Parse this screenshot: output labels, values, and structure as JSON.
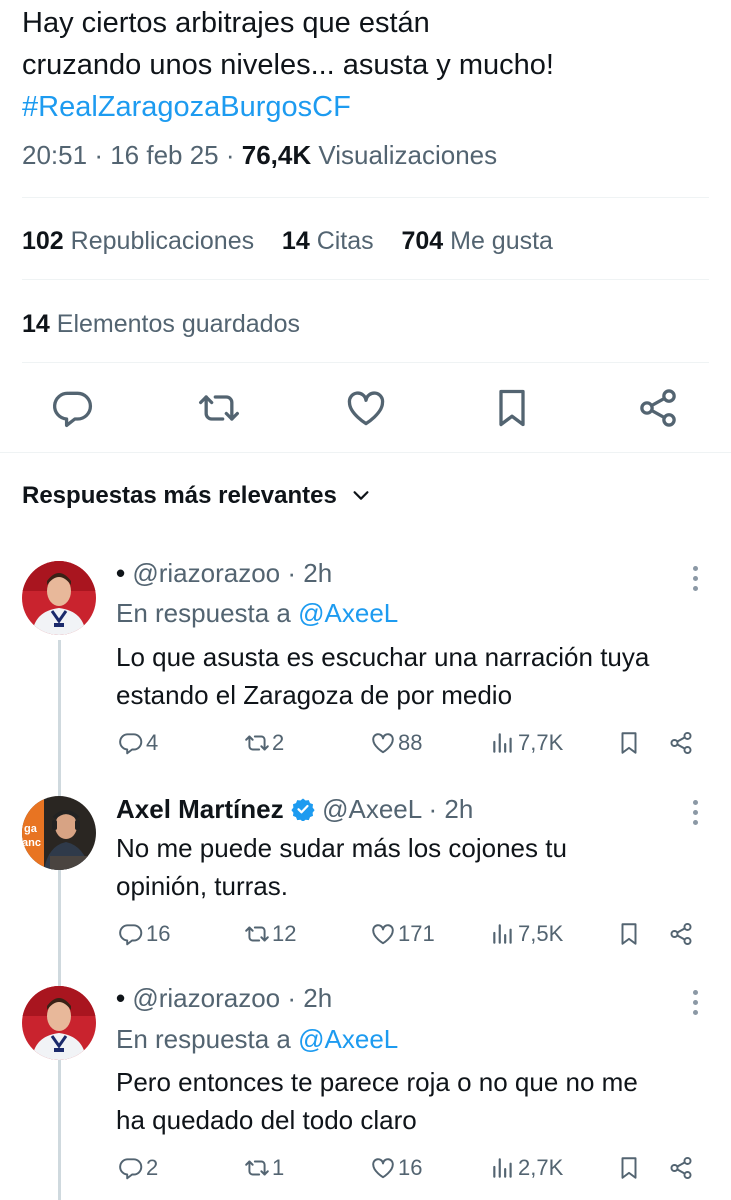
{
  "tweet": {
    "text_line1": "Hay ciertos arbitrajes que están",
    "text_line2": "cruzando unos niveles... asusta y mucho!",
    "hashtag": "#RealZaragozaBurgosCF",
    "time": "20:51",
    "date": "16 feb 25",
    "views_count": "76,4K",
    "views_label": "Visualizaciones"
  },
  "stats": {
    "reposts_count": "102",
    "reposts_label": "Republicaciones",
    "quotes_count": "14",
    "quotes_label": "Citas",
    "likes_count": "704",
    "likes_label": "Me gusta",
    "bookmarks_count": "14",
    "bookmarks_label": "Elementos guardados"
  },
  "actions": {
    "icons": [
      "reply-icon",
      "retweet-icon",
      "like-icon",
      "bookmark-icon",
      "share-icon"
    ]
  },
  "replies_section": {
    "title": "Respuestas más relevantes"
  },
  "replies": [
    {
      "name": "•",
      "handle": "@riazorazoo",
      "time": "2h",
      "reply_to_label": "En respuesta a",
      "reply_to_handle": "@AxeeL",
      "text_line1": "Lo que asusta es escuchar una narración tuya",
      "text_line2": "estando el Zaragoza de por medio",
      "replies": "4",
      "retweets": "2",
      "likes": "88",
      "views": "7,7K"
    },
    {
      "name": "Axel Martínez",
      "handle": "@AxeeL",
      "time": "2h",
      "text_line1": "No me puede sudar más los cojones tu",
      "text_line2": "opinión, turras.",
      "replies": "16",
      "retweets": "12",
      "likes": "171",
      "views": "7,5K"
    },
    {
      "name": "•",
      "handle": "@riazorazoo",
      "time": "2h",
      "reply_to_label": "En respuesta a",
      "reply_to_handle": "@AxeeL",
      "text_line1": "Pero entonces te parece roja o no que no me",
      "text_line2": "ha quedado del todo claro",
      "replies": "2",
      "retweets": "1",
      "likes": "16",
      "views": "2,7K"
    }
  ],
  "colors": {
    "link": "#1d9bf0",
    "secondary_text": "#536471",
    "primary_text": "#0f1419",
    "verified": "#1d9bf0"
  }
}
